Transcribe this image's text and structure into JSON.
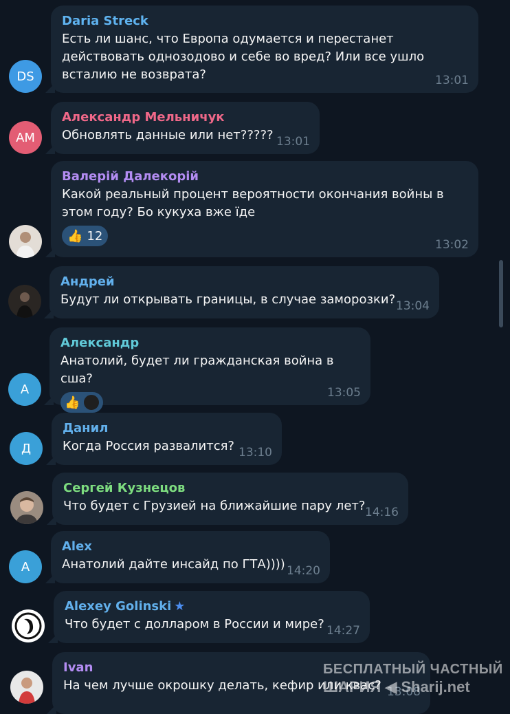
{
  "colors": {
    "background": "#0e1621",
    "bubble": "#182533",
    "time": "#6d7f8f",
    "reaction_bg": "#2b5278"
  },
  "messages": [
    {
      "initials": "DS",
      "avatar_color": "#3e9ae4",
      "name": "Daria Streck",
      "name_color": "#5fb3f0",
      "text": "Есть ли шанс, что Европа одумается и перестанет действовать однозодово и себе во вред? Или все ушло всталию не возврата?",
      "time": "13:01"
    },
    {
      "initials": "АМ",
      "avatar_color": "#e35d74",
      "name": "Александр Мельничук",
      "name_color": "#f06889",
      "text": "Обновлять данные или нет?????",
      "time": "13:01"
    },
    {
      "initials": "",
      "avatar_color": "#d7d2cc",
      "name": "Валерій Далекорій",
      "name_color": "#b38cf2",
      "text": "Какой реальный процент вероятности окончания войны в этом году? Бо кукуха вже їде",
      "time": "13:02",
      "reaction_emoji": "👍",
      "reaction_count": "12"
    },
    {
      "initials": "",
      "avatar_color": "#2a2623",
      "name": "Андрей",
      "name_color": "#62b0ec",
      "text": "Будут ли открывать границы, в случае заморозки?",
      "time": "13:04"
    },
    {
      "initials": "А",
      "avatar_color": "#3aa0d8",
      "name": "Александр",
      "name_color": "#61c9d8",
      "text": "Анатолий,  будет ли гражданская война в сша?",
      "time": "13:05",
      "reaction_emoji": "👍"
    },
    {
      "initials": "Д",
      "avatar_color": "#3aa0d8",
      "name": "Данил",
      "name_color": "#62b0ec",
      "text": "Когда Россия развалится?",
      "time": "13:10"
    },
    {
      "initials": "",
      "avatar_color": "#8a7d72",
      "name": "Сергей Кузнецов",
      "name_color": "#7ddc7f",
      "text": "Что будет с Грузией на ближайшие пару лет?",
      "time": "14:16"
    },
    {
      "initials": "А",
      "avatar_color": "#3aa0d8",
      "name": "Alex",
      "name_color": "#62b0ec",
      "text": "Анатолий дайте инсайд по ГТА))))",
      "time": "14:20"
    },
    {
      "initials": "",
      "avatar_color": "#ffffff",
      "name": "Alexey Golinski",
      "name_color": "#62b0ec",
      "text": "Что будет с долларом в России и мире?",
      "time": "14:27"
    },
    {
      "initials": "",
      "avatar_color": "#e8e8e8",
      "name": "Ivan",
      "name_color": "#b38cf2",
      "text": "На чем лучше окрошку делать, кефир или квас?",
      "time": "13:08"
    }
  ],
  "watermark": {
    "line1": "БЕСПЛАТНЫЙ ЧАСТНЫЙ",
    "line2": "ШАРИЯ ◀ Sharij.net"
  }
}
